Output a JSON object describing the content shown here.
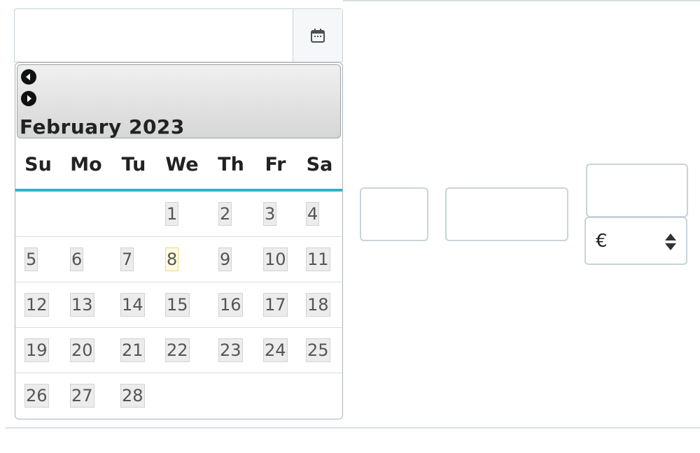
{
  "datepicker": {
    "title": "February 2023",
    "weekdays": [
      "Su",
      "Mo",
      "Tu",
      "We",
      "Th",
      "Fr",
      "Sa"
    ],
    "weeks": [
      [
        "",
        "",
        "",
        "1",
        "2",
        "3",
        "4"
      ],
      [
        "5",
        "6",
        "7",
        "8",
        "9",
        "10",
        "11"
      ],
      [
        "12",
        "13",
        "14",
        "15",
        "16",
        "17",
        "18"
      ],
      [
        "19",
        "20",
        "21",
        "22",
        "23",
        "24",
        "25"
      ],
      [
        "26",
        "27",
        "28",
        "",
        "",
        "",
        ""
      ]
    ],
    "highlighted_day": "8"
  },
  "date_field": {
    "value": "",
    "button_icon": "calendar-icon"
  },
  "currency_select": {
    "value": "€",
    "icon": "sort-arrows-icon"
  },
  "colors": {
    "accent": "#2fb3c8",
    "border": "#c9d4d8",
    "today_bg": "#fffbe0"
  }
}
